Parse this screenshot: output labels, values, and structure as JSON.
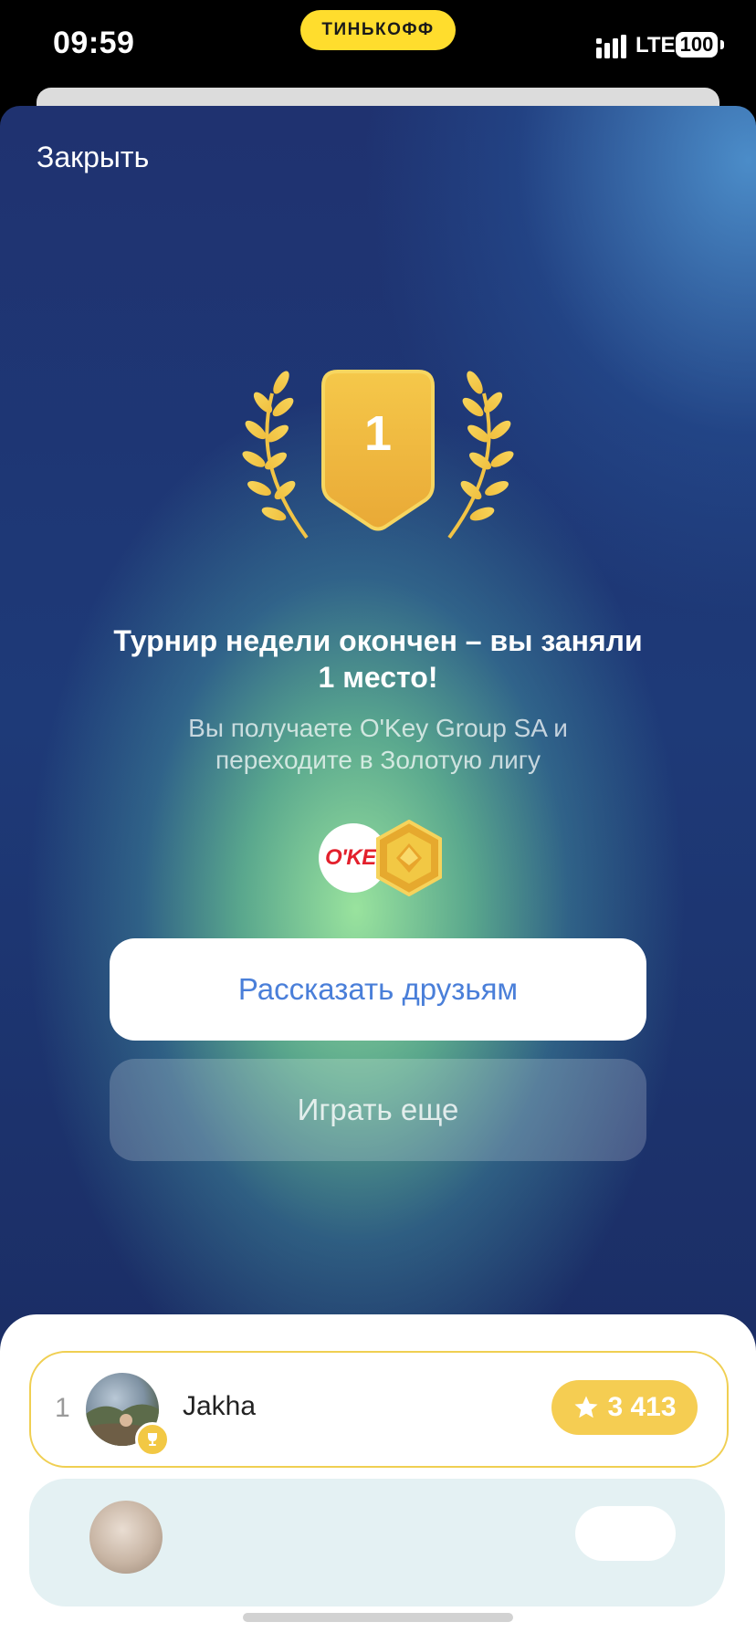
{
  "status_bar": {
    "time": "09:59",
    "brand": "ТИНЬКОФФ",
    "network": "LTE",
    "battery": "100"
  },
  "header": {
    "close_label": "Закрыть"
  },
  "award": {
    "place": "1"
  },
  "result": {
    "title": "Турнир недели окончен – вы заняли 1 место!",
    "subtitle": "Вы получаете O'Key Group SA и переходите в Золотую лигу"
  },
  "prize": {
    "logo_text": "O'KEI",
    "logo_color": "#e3202c",
    "league_color": "#f2c844"
  },
  "actions": {
    "share_label": "Рассказать друзьям",
    "play_again_label": "Играть еще"
  },
  "leaderboard": {
    "rows": [
      {
        "rank": "1",
        "name": "Jakha",
        "score": "3 413"
      }
    ]
  },
  "colors": {
    "accent_yellow": "#ffdd2d",
    "button_text_blue": "#4a7fd9",
    "score_pill": "#f5cd52"
  }
}
